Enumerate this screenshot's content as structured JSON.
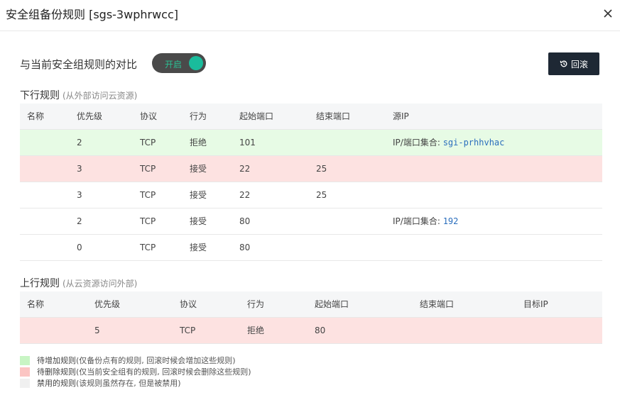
{
  "dialog": {
    "title": "安全组备份规则 [sgs-3wphrwcc]"
  },
  "compare": {
    "label": "与当前安全组规则的对比",
    "toggle_label": "开启",
    "rollback_label": "回滚"
  },
  "inbound": {
    "title": "下行规则",
    "subtitle": "(从外部访问云资源)",
    "columns": [
      "名称",
      "优先级",
      "协议",
      "行为",
      "起始端口",
      "结束端口",
      "源IP"
    ],
    "rows": [
      {
        "state": "add",
        "name": "",
        "priority": "2",
        "protocol": "TCP",
        "action": "拒绝",
        "start_port": "101",
        "end_port": "",
        "ip_prefix": "IP/端口集合: ",
        "ip_link": "sgi-prhhvhac"
      },
      {
        "state": "del",
        "name": "",
        "priority": "3",
        "protocol": "TCP",
        "action": "接受",
        "start_port": "22",
        "end_port": "25",
        "ip_prefix": "",
        "ip_link": ""
      },
      {
        "state": "normal",
        "name": "",
        "priority": "3",
        "protocol": "TCP",
        "action": "接受",
        "start_port": "22",
        "end_port": "25",
        "ip_prefix": "",
        "ip_link": ""
      },
      {
        "state": "normal",
        "name": "",
        "priority": "2",
        "protocol": "TCP",
        "action": "接受",
        "start_port": "80",
        "end_port": "",
        "ip_prefix": "IP/端口集合: ",
        "ip_link": "192"
      },
      {
        "state": "normal",
        "name": "",
        "priority": "0",
        "protocol": "TCP",
        "action": "接受",
        "start_port": "80",
        "end_port": "",
        "ip_prefix": "",
        "ip_link": ""
      }
    ]
  },
  "outbound": {
    "title": "上行规则",
    "subtitle": "(从云资源访问外部)",
    "columns": [
      "名称",
      "优先级",
      "协议",
      "行为",
      "起始端口",
      "结束端口",
      "目标IP"
    ],
    "rows": [
      {
        "state": "del",
        "name": "",
        "priority": "5",
        "protocol": "TCP",
        "action": "拒绝",
        "start_port": "80",
        "end_port": "",
        "ip_prefix": "",
        "ip_link": ""
      }
    ]
  },
  "legend": [
    {
      "color": "#c8f5c4",
      "label": "待增加规则",
      "desc": "(仅备份点有的规则, 回滚时候会增加这些规则)"
    },
    {
      "color": "#fbc5c3",
      "label": "待删除规则",
      "desc": "(仅当前安全组有的规则, 回滚时候会删除这些规则)"
    },
    {
      "color": "#f0f0f0",
      "label": "禁用的规则",
      "desc": "(该规则虽然存在, 但是被禁用)"
    }
  ],
  "colors": {
    "add_row": "#e7fbe5",
    "del_row": "#fde2e1",
    "toggle_knob": "#1abc9c",
    "button_bg": "#1e2834",
    "link": "#2a6ebd"
  }
}
